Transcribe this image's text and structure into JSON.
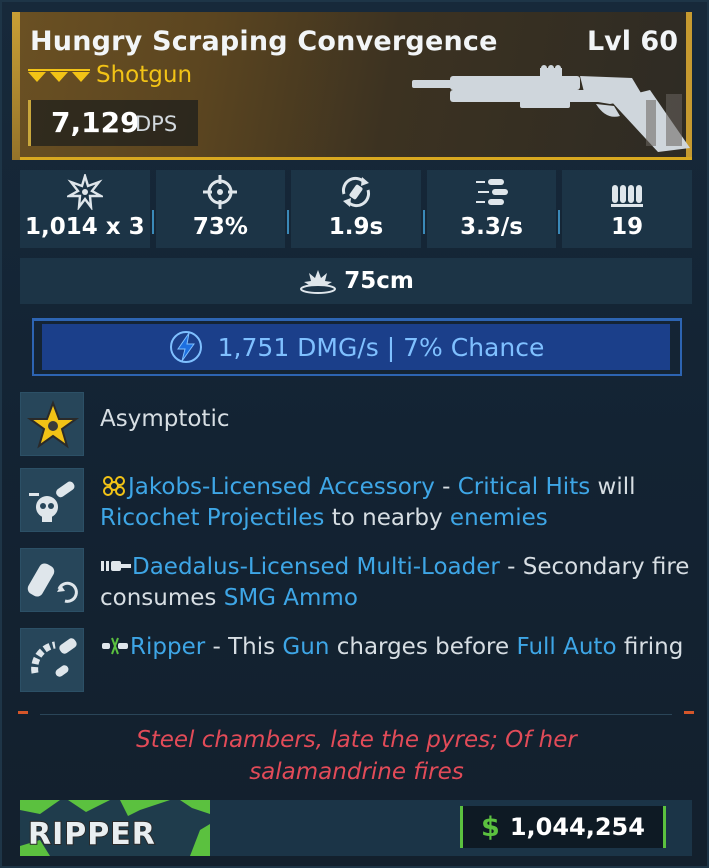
{
  "weapon": {
    "name": "Hungry Scraping Convergence",
    "level": "Lvl 60",
    "type": "Shotgun",
    "rarity_icon": "rarity-chevrons-icon",
    "dps_value": "7,129",
    "dps_unit": "DPS",
    "gun_icon": "shotgun-icon"
  },
  "stats": [
    {
      "icon": "damage-burst-icon",
      "value": "1,014 x 3"
    },
    {
      "icon": "accuracy-crosshair-icon",
      "value": "73%"
    },
    {
      "icon": "reload-icon",
      "value": "1.9s"
    },
    {
      "icon": "fire-rate-icon",
      "value": "3.3/s"
    },
    {
      "icon": "magazine-icon",
      "value": "19"
    }
  ],
  "splash": {
    "icon": "splash-radius-icon",
    "value": "75cm"
  },
  "element": {
    "icon": "shock-bolt-icon",
    "text": "1,751 DMG/s | 7% Chance"
  },
  "perks": [
    {
      "icon": "star-badge-icon",
      "title": "Asymptotic"
    },
    {
      "icon": "skull-bullet-icon",
      "parts": [
        "Jakobs-Licensed Accessory",
        " - ",
        "Critical Hits",
        " will ",
        "Ricochet Projectiles",
        " to nearby ",
        "enemies"
      ]
    },
    {
      "icon": "loader-cycle-icon",
      "parts": [
        "Daedalus-Licensed Multi-Loader",
        " - Secondary fire consumes ",
        "SMG Ammo"
      ]
    },
    {
      "icon": "charge-arc-icon",
      "parts": [
        "Ripper",
        " - This ",
        "Gun",
        " charges before ",
        "Full Auto",
        " firing"
      ]
    }
  ],
  "flavor": {
    "line1": "Steel chambers, late the pyres; Of her",
    "line2": "salamandrine fires"
  },
  "footer": {
    "manufacturer_logo": "ripper-logo",
    "manufacturer_text": "RIPPER",
    "currency_icon": "$",
    "price": "1,044,254"
  },
  "colors": {
    "rarity": "#f2c316",
    "highlight": "#3ea6e6",
    "element": "#7fc0ff",
    "flavor": "#e24b58",
    "money": "#5bc13f"
  }
}
